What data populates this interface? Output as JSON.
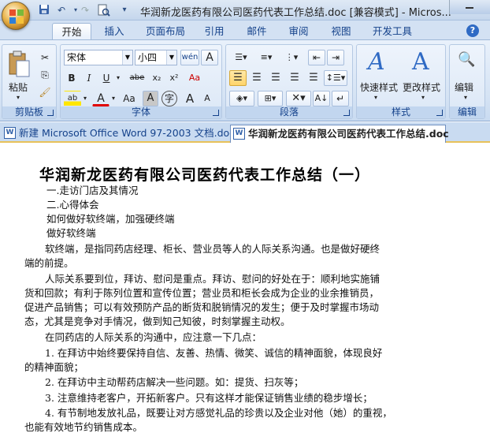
{
  "window": {
    "title": "华润新龙医药有限公司医药代表工作总结.doc [兼容模式] - Micros..."
  },
  "quick_access": {
    "icons": [
      "save-icon",
      "undo-icon",
      "redo-icon",
      "print-preview-icon",
      "customize-icon"
    ]
  },
  "ribbon_tabs": [
    {
      "label": "开始",
      "active": true
    },
    {
      "label": "插入",
      "active": false
    },
    {
      "label": "页面布局",
      "active": false
    },
    {
      "label": "引用",
      "active": false
    },
    {
      "label": "邮件",
      "active": false
    },
    {
      "label": "审阅",
      "active": false
    },
    {
      "label": "视图",
      "active": false
    },
    {
      "label": "开发工具",
      "active": false
    }
  ],
  "groups": {
    "clipboard": {
      "label": "剪贴板",
      "paste_label": "粘贴"
    },
    "font": {
      "label": "字体",
      "font_name": "宋体",
      "font_size": "小四",
      "wen": "wén",
      "font_grow": "A",
      "bold": "B",
      "italic": "I",
      "underline": "U",
      "strike": "abe",
      "sub": "x₂",
      "sup": "x²",
      "clear": "Aa",
      "change_case": "Aa",
      "highlight": "ab",
      "font_color": "A",
      "char_shade": "A",
      "char_border": "A",
      "enclose": "字"
    },
    "paragraph": {
      "label": "段落"
    },
    "styles": {
      "label": "样式",
      "quick_styles": "快速样式",
      "change_styles": "更改样式"
    },
    "editing": {
      "label": "编辑",
      "edit_label": "编辑"
    }
  },
  "doc_tabs": [
    {
      "label": "新建 Microsoft Office Word 97-2003 文档.doc",
      "active": false
    },
    {
      "label": "华润新龙医药有限公司医药代表工作总结.doc",
      "active": true
    }
  ],
  "document": {
    "title": "华润新龙医药有限公司医药代表工作总结（一）",
    "lines": [
      "一.走访门店及其情况",
      "二.心得体会",
      "如何做好软终端，加强硬终端",
      "做好软终端",
      "软终端，是指同药店经理、柜长、营业员等人的人际关系沟通。也是做好硬终",
      "端的前提。",
      "人际关系要到位，拜访、慰问是重点。拜访、慰问的好处在于：顺利地实施铺",
      "货和回款；有利于陈列位置和宣传位置；营业员和柜长会成为企业的业余推销员，",
      "促进产品销售；可以有效预防产品的断货和脱销情况的发生；便于及时掌握市场动",
      "态，尤其是竞争对手情况，做到知己知彼，时刻掌握主动权。",
      "在同药店的人际关系的沟通中，应注意一下几点：",
      "1.  在拜访中始终要保持自信、友善、热情、微笑、诚信的精神面貌，体现良好",
      "的精神面貌；",
      "2.  在拜访中主动帮药店解决一些问题。如：提货、扫灰等；",
      "3.  注意维持老客户，开拓新客户。只有这样才能保证销售业绩的稳步增长；",
      "4.  有节制地发放礼品，既要让对方感觉礼品的珍贵以及企业对他（她）的重视，",
      "也能有效地节约销售成本。"
    ]
  }
}
